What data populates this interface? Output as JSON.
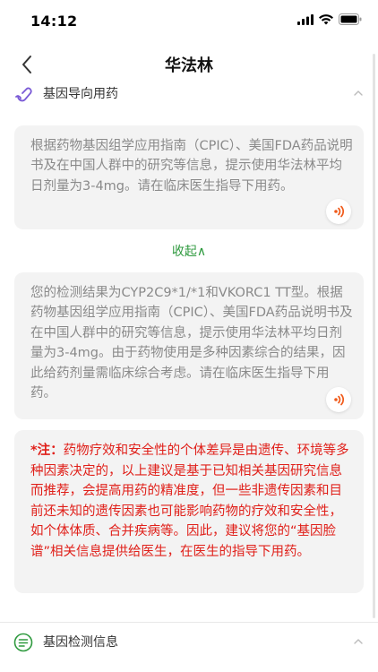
{
  "status_bar": {
    "time": "14:12",
    "icons": [
      "signal-icon",
      "wifi-icon",
      "battery-icon"
    ]
  },
  "nav": {
    "title": "华法林",
    "back_icon": "chevron-left-icon"
  },
  "section_dosing": {
    "title": "基因导向用药",
    "icon": "pill-icon",
    "toggle_icon": "chevron-up-icon"
  },
  "card_guideline": {
    "text": "根据药物基因组学应用指南（CPIC）、美国FDA药品说明书及在中国人群中的研究等信息，提示使用华法林平均日剂量为3-4mg。请在临床医生指导下用药。"
  },
  "collapse": {
    "label": "收起∧"
  },
  "card_result": {
    "text": "您的检测结果为CYP2C9*1/*1和VKORC1 TT型。根据药物基因组学应用指南（CPIC）、美国FDA药品说明书及在中国人群中的研究等信息，提示使用华法林平均日剂量为3-4mg。由于药物使用是多种因素综合的结果，因此给药剂量需临床综合考虑。请在临床医生指导下用药。"
  },
  "note": {
    "label": "*注：",
    "text": "药物疗效和安全性的个体差异是由遗传、环境等多种因素决定的，以上建议是基于已知相关基因研究信息而推荐，会提高用药的精准度，但一些非遗传因素和目前还未知的遗传因素也可能影响药物的疗效和安全性，如个体体质、合并疾病等。因此，建议将您的“基因脸谱”相关信息提供给医生，在医生的指导下用药。"
  },
  "section_testing": {
    "title": "基因检测信息",
    "icon": "list-icon",
    "toggle_icon": "chevron-up-icon"
  },
  "colors": {
    "accent_green": "#2f9a3f",
    "note_red": "#e0201a",
    "sound_orange": "#f05a1a",
    "card_bg": "#f3f3f3",
    "icon_purple": "#7a5ad6"
  }
}
